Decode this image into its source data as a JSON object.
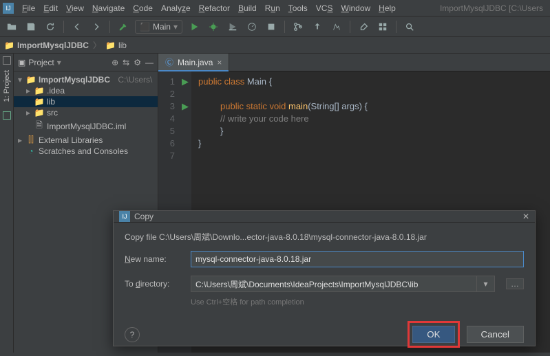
{
  "menubar": {
    "items": [
      "File",
      "Edit",
      "View",
      "Navigate",
      "Code",
      "Analyze",
      "Refactor",
      "Build",
      "Run",
      "Tools",
      "VCS",
      "Window",
      "Help"
    ],
    "project_label": "ImportMysqlJDBC [C:\\Users"
  },
  "run_config": {
    "label": "Main",
    "run_icon": "run",
    "debug_icon": "debug"
  },
  "breadcrumb": {
    "project": "ImportMysqlJDBC",
    "folder": "lib"
  },
  "leftbar": {
    "label": "1: Project"
  },
  "project_pane": {
    "title": "Project"
  },
  "tree": {
    "root": {
      "name": "ImportMysqlJDBC",
      "path": "C:\\Users\\"
    },
    "idea": ".idea",
    "lib": "lib",
    "src": "src",
    "iml": "ImportMysqlJDBC.iml",
    "ext": "External Libraries",
    "scratch": "Scratches and Consoles"
  },
  "editor": {
    "tab": "Main.java",
    "lines": [
      "1",
      "2",
      "3",
      "4",
      "5",
      "6",
      "7"
    ],
    "code": {
      "l1a": "public class ",
      "l1b": "Main",
      "l1c": " {",
      "l3a": "public static void ",
      "l3b": "main",
      "l3c": "(String[] args) {",
      "l4": "// write your code here",
      "l5": "}",
      "l6": "}"
    }
  },
  "dialog": {
    "title": "Copy",
    "info": "Copy file C:\\Users\\周斌\\Downlo...ector-java-8.0.18\\mysql-connector-java-8.0.18.jar",
    "new_name_label": "New name:",
    "new_name_value": "mysql-connector-java-8.0.18.jar",
    "to_dir_label": "To directory:",
    "to_dir_value": "C:\\Users\\周斌\\Documents\\IdeaProjects\\ImportMysqlJDBC\\lib",
    "hint": "Use Ctrl+空格 for path completion",
    "ok": "OK",
    "cancel": "Cancel"
  }
}
